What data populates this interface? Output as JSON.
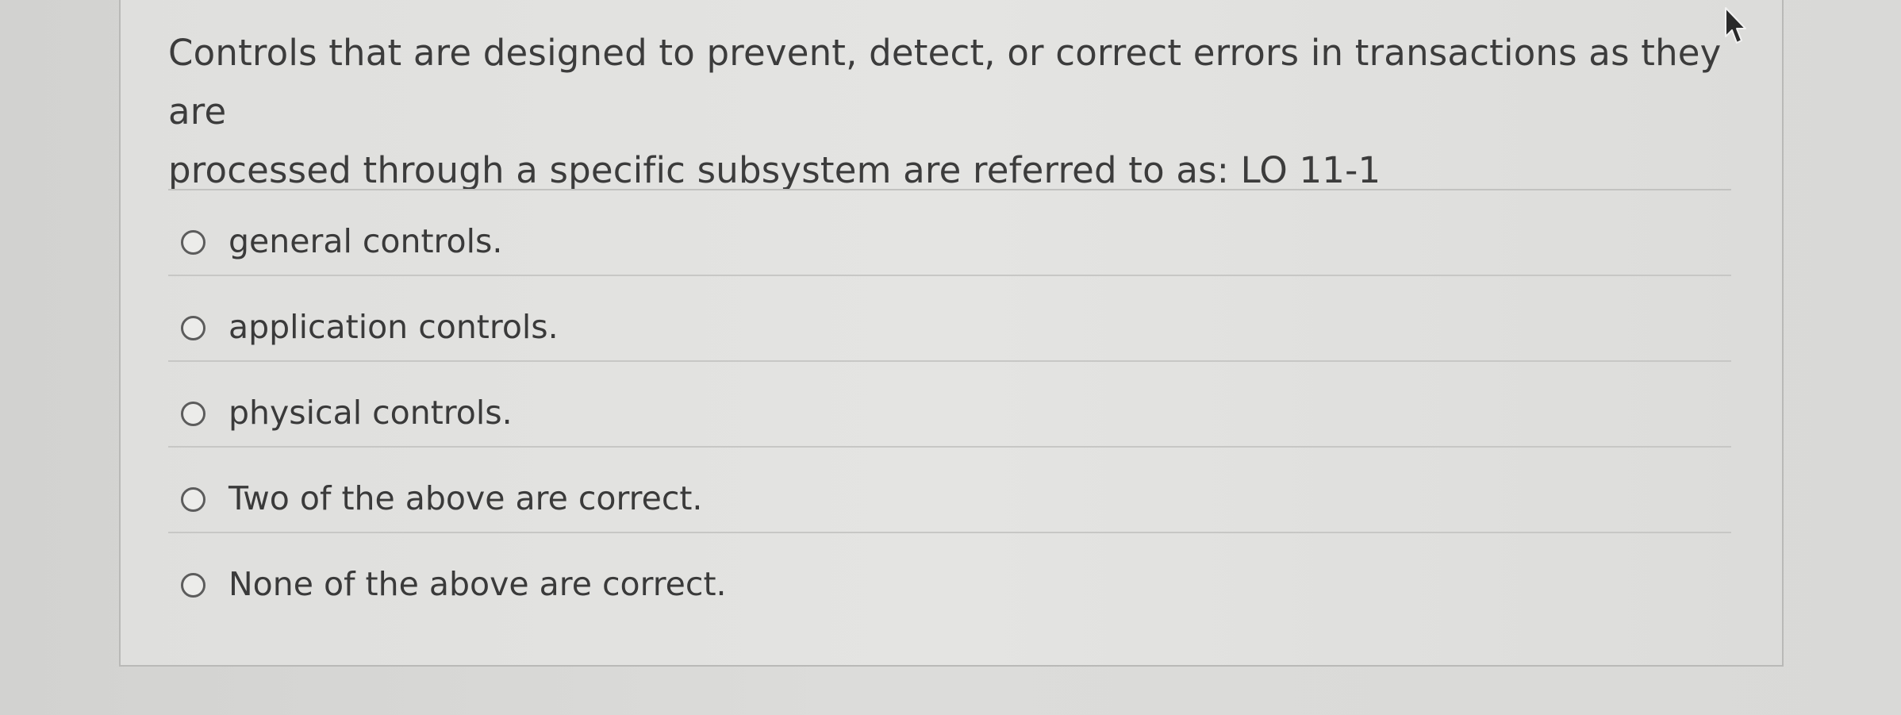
{
  "question": {
    "text_line1": "Controls that are designed to prevent, detect, or correct errors in transactions as they are",
    "text_line2": "processed through a specific subsystem are referred to as: LO 11-1"
  },
  "options": [
    {
      "label": "general controls.",
      "selected": false
    },
    {
      "label": "application controls.",
      "selected": false
    },
    {
      "label": "physical controls.",
      "selected": false
    },
    {
      "label": "Two of the above are correct.",
      "selected": false
    },
    {
      "label": "None of the above are correct.",
      "selected": false
    }
  ],
  "colors": {
    "background": "#d6d6d4",
    "card": "#e2e2e0",
    "text": "#3c3c3c",
    "divider": "#c2c2c0"
  },
  "icons": {
    "radio": "radio-button-unchecked-icon",
    "pointer": "mouse-pointer-icon"
  }
}
